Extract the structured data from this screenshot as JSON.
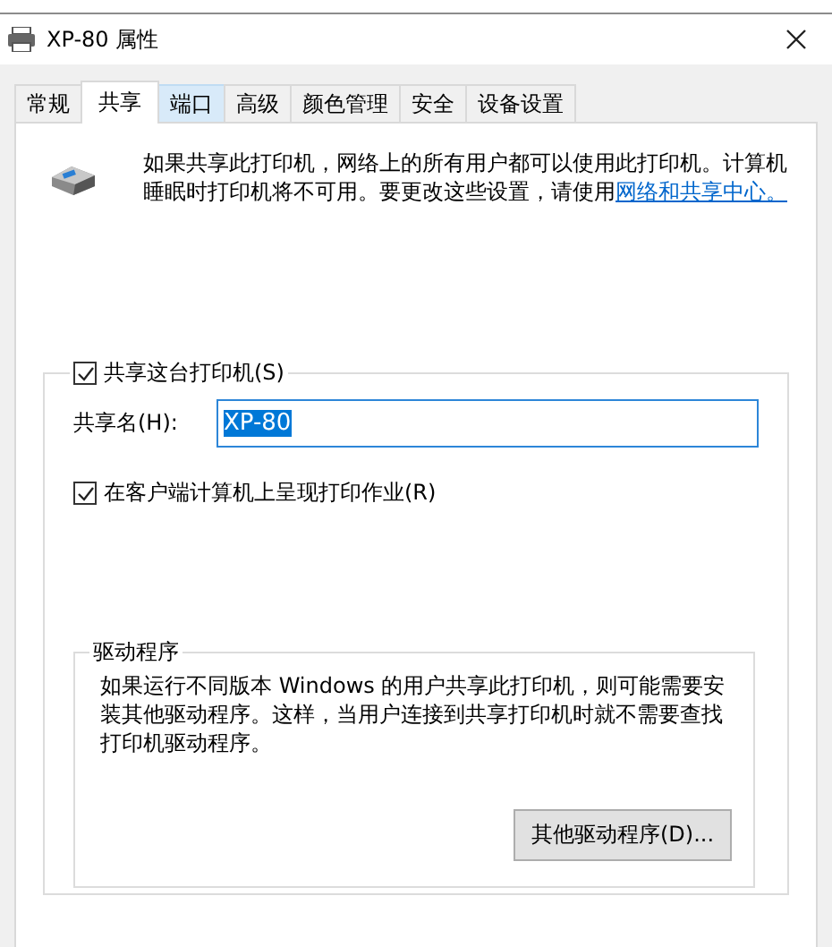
{
  "window": {
    "title": "XP-80 属性"
  },
  "tabs": [
    {
      "label": "常规",
      "selected": false,
      "hovered": false
    },
    {
      "label": "共享",
      "selected": true,
      "hovered": false
    },
    {
      "label": "端口",
      "selected": false,
      "hovered": true
    },
    {
      "label": "高级",
      "selected": false,
      "hovered": false
    },
    {
      "label": "颜色管理",
      "selected": false,
      "hovered": false
    },
    {
      "label": "安全",
      "selected": false,
      "hovered": false
    },
    {
      "label": "设备设置",
      "selected": false,
      "hovered": false
    }
  ],
  "description": {
    "text": "如果共享此打印机，网络上的所有用户都可以使用此打印机。计算机睡眠时打印机将不可用。要更改这些设置，请使用",
    "link": "网络和共享中心。"
  },
  "share": {
    "checkbox": {
      "label": "共享这台打印机(S)",
      "checked": true
    },
    "share_name": {
      "label": "共享名(H):",
      "value": "XP-80",
      "text_selected": true
    },
    "render_jobs": {
      "label": "在客户端计算机上呈现打印作业(R)",
      "checked": true
    }
  },
  "drivers": {
    "title": "驱动程序",
    "text": "如果运行不同版本 Windows 的用户共享此打印机，则可能需要安装其他驱动程序。这样，当用户连接到共享打印机时就不需要查找打印机驱动程序。",
    "button": "其他驱动程序(D)..."
  }
}
